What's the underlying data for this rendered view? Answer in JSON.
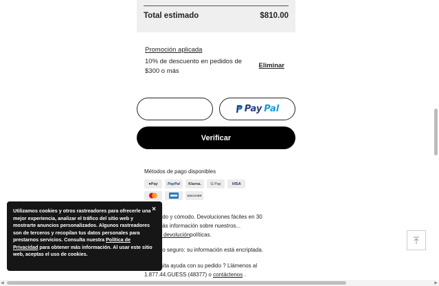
{
  "summary": {
    "total_label": "Total estimado",
    "total_value": "$810.00"
  },
  "promo": {
    "title": "Promoción aplicada",
    "description": "10% de descuento en pedidos de $300 o más",
    "remove_label": "Eliminar"
  },
  "buttons": {
    "paypal_prefix": "Pay",
    "paypal_suffix": "Pal",
    "verify_label": "Verificar"
  },
  "payment_methods": {
    "title": "Métodos de pago disponibles",
    "badges": [
      "Pay",
      "PayPal",
      "Klarna.",
      "G Pay",
      "VISA",
      "",
      "",
      "DISCOVER"
    ]
  },
  "shipping": {
    "line1": "vío rápido y cómodo. Devoluciones fáciles en 30",
    "line2": "días. Más información sobre nuestros...",
    "link": "envío y devolución",
    "link_suffix": "políticas."
  },
  "secure": {
    "text": "Pago seguro: su información está encriptada."
  },
  "help": {
    "line1": "¿Necesita ayuda con su pedido ? Llámenos al",
    "phone": "1.877.44.GUESS (48377) o",
    "contact_link": "contáctenos",
    "tail": "."
  },
  "cookie": {
    "close": "×",
    "text_a": "Utilizamos cookies y otros rastreadores para ofrecerle una mejor experiencia, analizar el tráfico del sitio web y mostrarte anuncios personalizados. Algunos rastreadores son de terceros y recopilan tus datos personales para prestarnos servicios. Consulta nuestra",
    "policy_link": "Política de Privacidad",
    "text_b": "para obtener más información. Al usar este sitio web, aceptas el uso de cookies."
  },
  "colors": {
    "paypal_dark": "#253b80",
    "paypal_light": "#179bd7",
    "verify_bg": "#000000",
    "cookie_bg": "#161616"
  }
}
